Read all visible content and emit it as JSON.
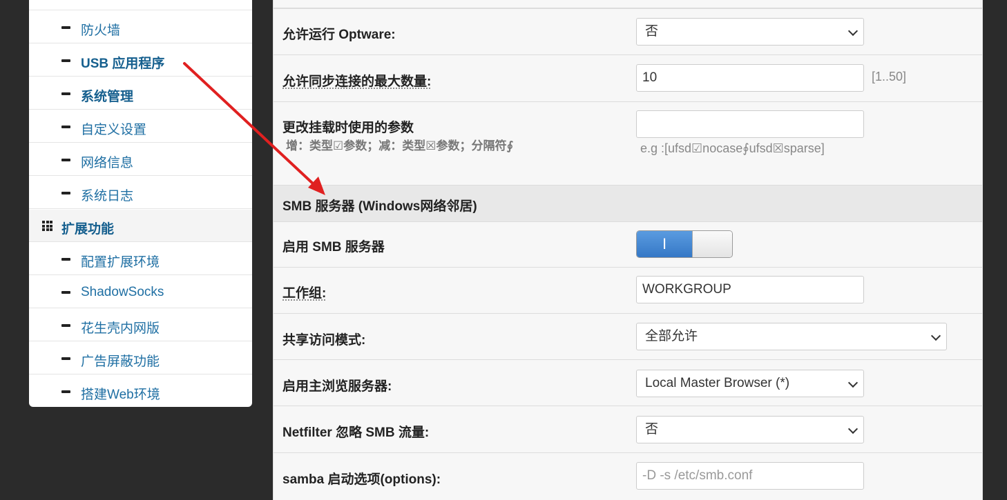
{
  "sidebar": {
    "items": [
      {
        "label": "防火墙",
        "type": "sub",
        "bold": false
      },
      {
        "label": "USB 应用程序",
        "type": "sub",
        "bold": true
      },
      {
        "label": "系统管理",
        "type": "sub",
        "bold": true
      },
      {
        "label": "自定义设置",
        "type": "sub",
        "bold": false
      },
      {
        "label": "网络信息",
        "type": "sub",
        "bold": false
      },
      {
        "label": "系统日志",
        "type": "sub",
        "bold": false
      },
      {
        "label": "扩展功能",
        "type": "group",
        "bold": true
      },
      {
        "label": "配置扩展环境",
        "type": "sub",
        "bold": false
      },
      {
        "label": "ShadowSocks",
        "type": "sub",
        "bold": false
      },
      {
        "label": "花生壳内网版",
        "type": "sub",
        "bold": false
      },
      {
        "label": "广告屏蔽功能",
        "type": "sub",
        "bold": false
      },
      {
        "label": "搭建Web环境",
        "type": "sub",
        "bold": false
      }
    ]
  },
  "form": {
    "optware": {
      "label": "允许运行 Optware:",
      "value": "否"
    },
    "max_conn": {
      "label": "允许同步连接的最大数量:",
      "value": "10",
      "range": "[1..50]"
    },
    "mount_params": {
      "label": "更改挂载时使用的参数",
      "sublabel": "增：类型☑参数；减：类型☒参数；分隔符∮",
      "value": "",
      "example": "e.g :[ufsd☑nocase∮ufsd☒sparse]"
    },
    "smb_section": "SMB 服务器 (Windows网络邻居)",
    "smb_enable": {
      "label": "启用 SMB 服务器",
      "state": "I"
    },
    "workgroup": {
      "label": "工作组:",
      "value": "WORKGROUP"
    },
    "share_mode": {
      "label": "共享访问模式:",
      "value": "全部允许"
    },
    "master_browser": {
      "label": "启用主浏览服务器:",
      "value": "Local Master Browser (*)"
    },
    "netfilter": {
      "label": "Netfilter 忽略 SMB 流量:",
      "value": "否"
    },
    "samba_opts": {
      "label": "samba 启动选项(options):",
      "placeholder": "-D -s /etc/smb.conf"
    }
  },
  "colors": {
    "arrow": "#e02020",
    "link": "#1f6fa3",
    "toggle_on": "#3578c6"
  }
}
